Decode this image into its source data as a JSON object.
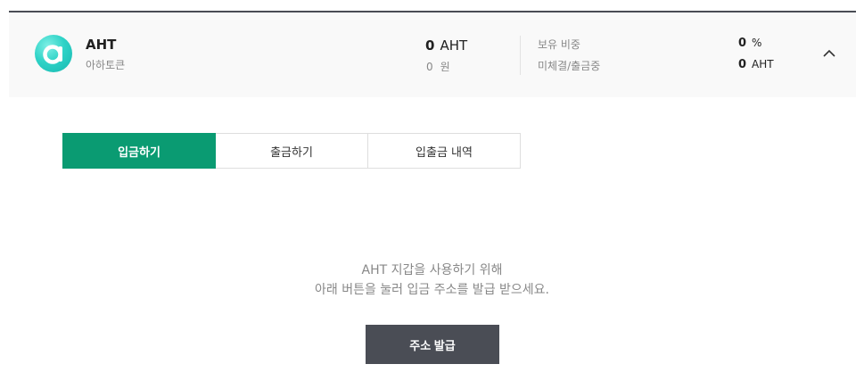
{
  "coin": {
    "symbol": "AHT",
    "name": "아하토큰",
    "balance_amount": "0",
    "balance_unit": "AHT",
    "krw_amount": "0",
    "krw_unit": "원",
    "logo_color": "#2fd3c7"
  },
  "stats": {
    "holding_ratio_label": "보유 비중",
    "holding_ratio_value": "0",
    "holding_ratio_unit": "%",
    "pending_label": "미체결/출금중",
    "pending_value": "0",
    "pending_unit": "AHT"
  },
  "tabs": [
    {
      "label": "입금하기",
      "active": true
    },
    {
      "label": "출금하기",
      "active": false
    },
    {
      "label": "입출금 내역",
      "active": false
    }
  ],
  "info": {
    "line1": "AHT 지갑을 사용하기 위해",
    "line2": "아래 버튼을 눌러 입금 주소를 발급 받으세요."
  },
  "button": {
    "issue_address_label": "주소 발급"
  },
  "colors": {
    "accent_green": "#0a9b72",
    "dark_button": "#4a4d55"
  },
  "icons": {
    "collapse": "chevron-up-icon",
    "coin_logo": "aht-logo-icon"
  }
}
